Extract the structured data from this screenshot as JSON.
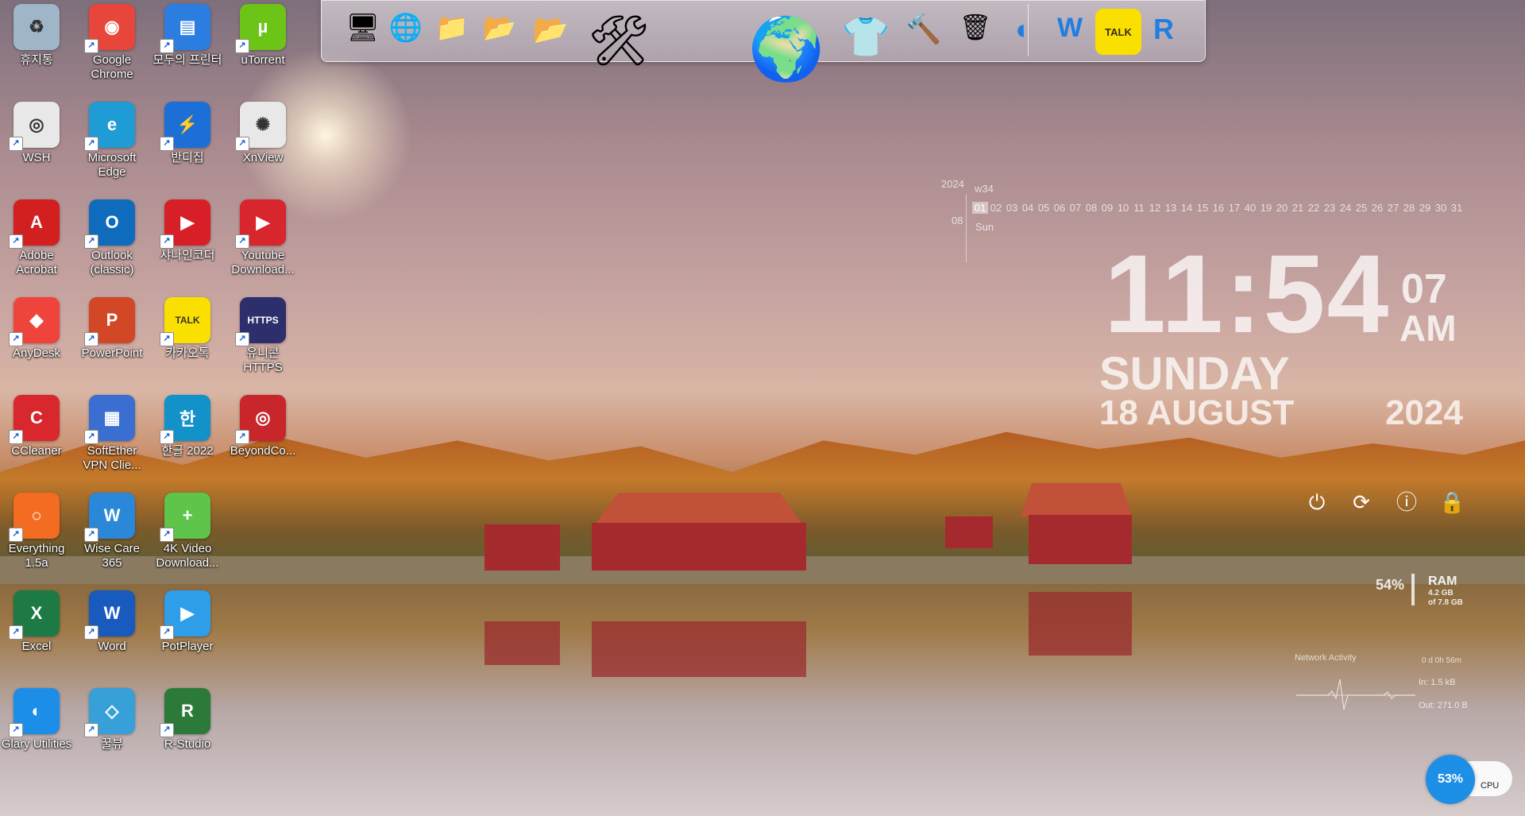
{
  "desktop": {
    "icons": [
      {
        "label": "휴지통",
        "color": "#9fb5c8",
        "glyph": "♻"
      },
      {
        "label": "Google Chrome",
        "color": "#e8463a",
        "glyph": "◉"
      },
      {
        "label": "모두의 프린터",
        "color": "#2b7de0",
        "glyph": "▤"
      },
      {
        "label": "uTorrent",
        "color": "#6cc417",
        "glyph": "µ"
      },
      {
        "label": "WSH",
        "color": "#e8e8e8",
        "glyph": "◎"
      },
      {
        "label": "Microsoft Edge",
        "color": "#1f9bd6",
        "glyph": "e"
      },
      {
        "label": "반디집",
        "color": "#1d6fd8",
        "glyph": "⚡"
      },
      {
        "label": "XnView",
        "color": "#e8e8e8",
        "glyph": "✺"
      },
      {
        "label": "Adobe Acrobat",
        "color": "#d21f1f",
        "glyph": "A"
      },
      {
        "label": "Outlook (classic)",
        "color": "#0f6cbd",
        "glyph": "O"
      },
      {
        "label": "샤나인코더",
        "color": "#d81f28",
        "glyph": "▶"
      },
      {
        "label": "Youtube Download...",
        "color": "#d8262e",
        "glyph": "▶"
      },
      {
        "label": "AnyDesk",
        "color": "#ef443b",
        "glyph": "◆"
      },
      {
        "label": "PowerPoint",
        "color": "#d24726",
        "glyph": "P"
      },
      {
        "label": "카카오톡",
        "color": "#f9e000",
        "glyph": "TALK"
      },
      {
        "label": "유니콘 HTTPS",
        "color": "#2c2f6b",
        "glyph": "HTTPS"
      },
      {
        "label": "CCleaner",
        "color": "#d8272d",
        "glyph": "C"
      },
      {
        "label": "SoftEther VPN Clie...",
        "color": "#3a6ed0",
        "glyph": "▦"
      },
      {
        "label": "한글 2022",
        "color": "#1391c9",
        "glyph": "한"
      },
      {
        "label": "BeyondCo...",
        "color": "#c9262c",
        "glyph": "◎"
      },
      {
        "label": "Everything 1.5a",
        "color": "#f36c21",
        "glyph": "○"
      },
      {
        "label": "Wise Care 365",
        "color": "#2b87d8",
        "glyph": "W"
      },
      {
        "label": "4K Video Download...",
        "color": "#5ec44a",
        "glyph": "+"
      },
      {
        "label": "Excel",
        "color": "#1e7a45",
        "glyph": "X"
      },
      {
        "label": "Word",
        "color": "#185abd",
        "glyph": "W"
      },
      {
        "label": "PotPlayer",
        "color": "#2f9ee8",
        "glyph": "▶"
      },
      {
        "label": "Glary Utilities",
        "color": "#1c8ee8",
        "glyph": "◐"
      },
      {
        "label": "꿀뷰",
        "color": "#37a0d8",
        "glyph": "◇"
      },
      {
        "label": "R-Studio",
        "color": "#2b7a3a",
        "glyph": "R"
      }
    ]
  },
  "dock": {
    "items": [
      {
        "name": "computer-icon",
        "glyph": "🖥"
      },
      {
        "name": "network-icon",
        "glyph": "🌐"
      },
      {
        "name": "folder-icon",
        "glyph": "📁"
      },
      {
        "name": "folder-pictures-icon",
        "glyph": "📂"
      },
      {
        "name": "folder-open-icon",
        "glyph": "📂"
      },
      {
        "name": "tools-icon",
        "glyph": "🛠"
      },
      {
        "name": "globe-icon",
        "glyph": "🌍"
      },
      {
        "name": "tshirt-icon",
        "glyph": "👕"
      },
      {
        "name": "hammer-icon",
        "glyph": "🔨"
      },
      {
        "name": "recycle-bin-icon",
        "glyph": "🗑"
      },
      {
        "name": "glary-icon",
        "glyph": "◐"
      },
      {
        "name": "wise-care-icon",
        "glyph": "W"
      },
      {
        "name": "kakaotalk-icon",
        "glyph": "TALK"
      },
      {
        "name": "r-studio-icon",
        "glyph": "R"
      }
    ]
  },
  "calendar": {
    "year": "2024",
    "week": "w34",
    "month": "08",
    "weekday": "Sun",
    "days": [
      "01",
      "02",
      "03",
      "04",
      "05",
      "06",
      "07",
      "08",
      "09",
      "10",
      "11",
      "12",
      "13",
      "14",
      "15",
      "16",
      "17",
      "40",
      "19",
      "20",
      "21",
      "22",
      "23",
      "24",
      "25",
      "26",
      "27",
      "28",
      "29",
      "30",
      "31"
    ],
    "today_index": 0
  },
  "clock": {
    "time": "11:54",
    "seconds": "07",
    "ampm": "AM",
    "day": "SUNDAY",
    "date": "18 AUGUST",
    "year": "2024"
  },
  "system": {
    "ram_percent": "54%",
    "ram_label": "RAM",
    "ram_used": "4.2 GB",
    "ram_total": "of 7.8 GB",
    "network_title": "Network Activity",
    "network_uptime": "0 d 0h 56m",
    "network_in": "In: 1.5 kB",
    "network_out": "Out: 271.0 B",
    "cpu_percent": "53%",
    "cpu_label": "CPU"
  }
}
